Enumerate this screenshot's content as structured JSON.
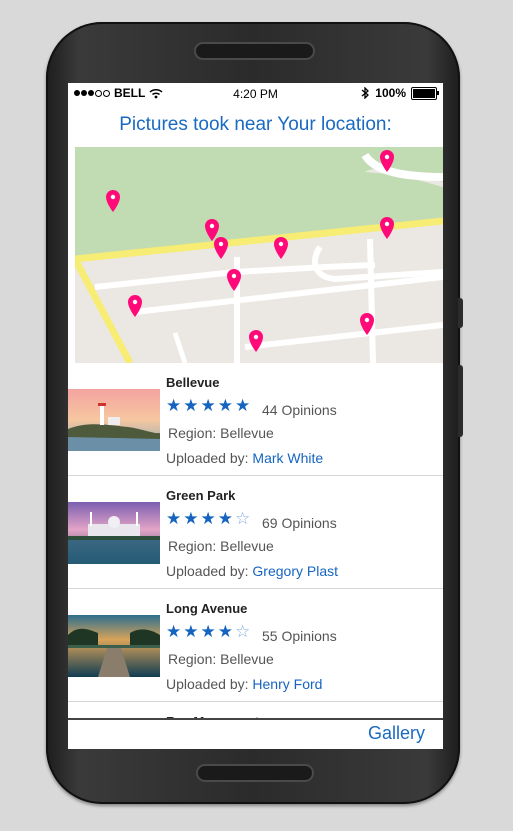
{
  "status": {
    "carrier": "BELL",
    "time": "4:20 PM",
    "battery": "100%",
    "signal_bars": 5,
    "signal_filled": 3
  },
  "header": {
    "title": "Pictures took near Your location:"
  },
  "map": {
    "pins": 11,
    "pin_color": "#ff0a78"
  },
  "list": {
    "items": [
      {
        "name": "Bellevue",
        "rating": 5,
        "opinions": "44 Opinions",
        "region": "Region: Bellevue",
        "uploaded_label": "Uploaded by:",
        "user": "Mark White"
      },
      {
        "name": "Green Park",
        "rating": 4.5,
        "opinions": "69 Opinions",
        "region": "Region: Bellevue",
        "uploaded_label": "Uploaded by:",
        "user": "Gregory Plast"
      },
      {
        "name": "Long Avenue",
        "rating": 4.5,
        "opinions": "55 Opinions",
        "region": "Region: Bellevue",
        "uploaded_label": "Uploaded by:",
        "user": "Henry Ford"
      },
      {
        "name": "Rac Monument"
      }
    ]
  },
  "footer": {
    "gallery": "Gallery"
  },
  "colors": {
    "accent": "#1a6ac2",
    "star": "#1565c0"
  }
}
